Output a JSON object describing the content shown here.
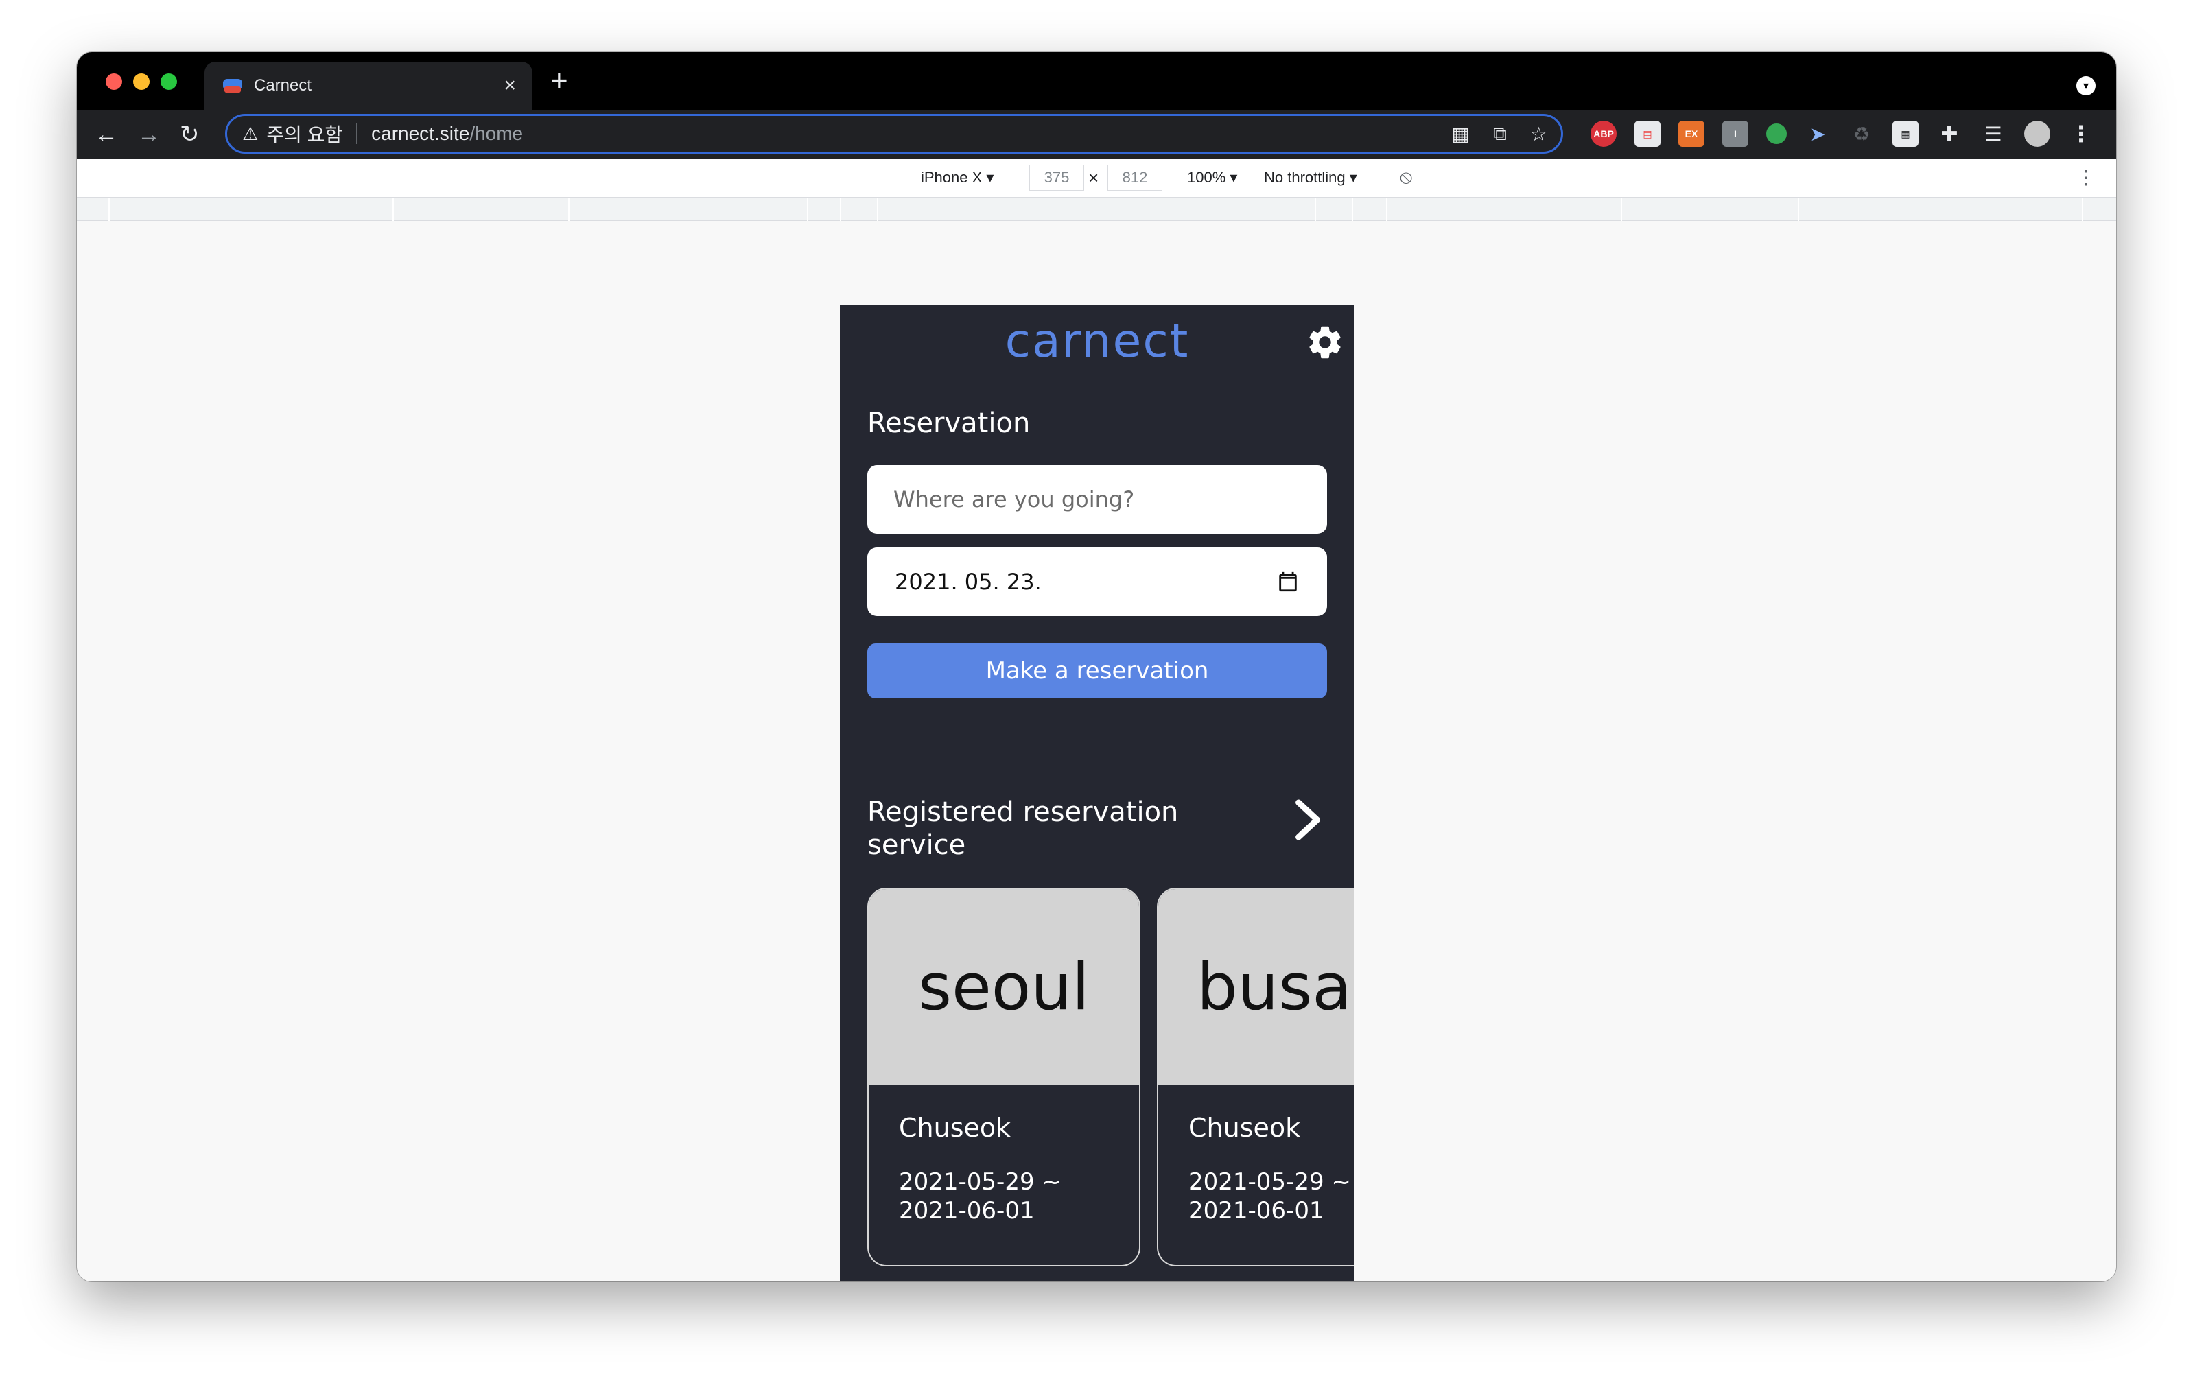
{
  "browser": {
    "tab_title": "Carnect",
    "tab_close": "×",
    "new_tab": "+",
    "security_warning": "주의 요함",
    "url_host": "carnect.site",
    "url_path": "/home",
    "ext_abp": "ABP",
    "ext_ex": "EX",
    "ext_i": "I"
  },
  "device_toolbar": {
    "device": "iPhone X ▾",
    "width": "375",
    "times": "×",
    "height": "812",
    "zoom": "100% ▾",
    "throttling": "No throttling ▾"
  },
  "app": {
    "logo": "carnect",
    "reservation_title": "Reservation",
    "destination_placeholder": "Where are you going?",
    "date_value": "2021. 05. 23.",
    "reserve_button": "Make a reservation",
    "registered_title": "Registered reservation service",
    "cards": [
      {
        "city": "seoul",
        "title": "Chuseok",
        "dates": "2021-05-29 ~ 2021-06-01"
      },
      {
        "city": "busa",
        "title": "Chuseok",
        "dates": "2021-05-29 ~ 2021-06-01"
      }
    ]
  },
  "colors": {
    "app_background": "#252731",
    "accent": "#5a85e3",
    "card_top": "#d3d3d3"
  }
}
